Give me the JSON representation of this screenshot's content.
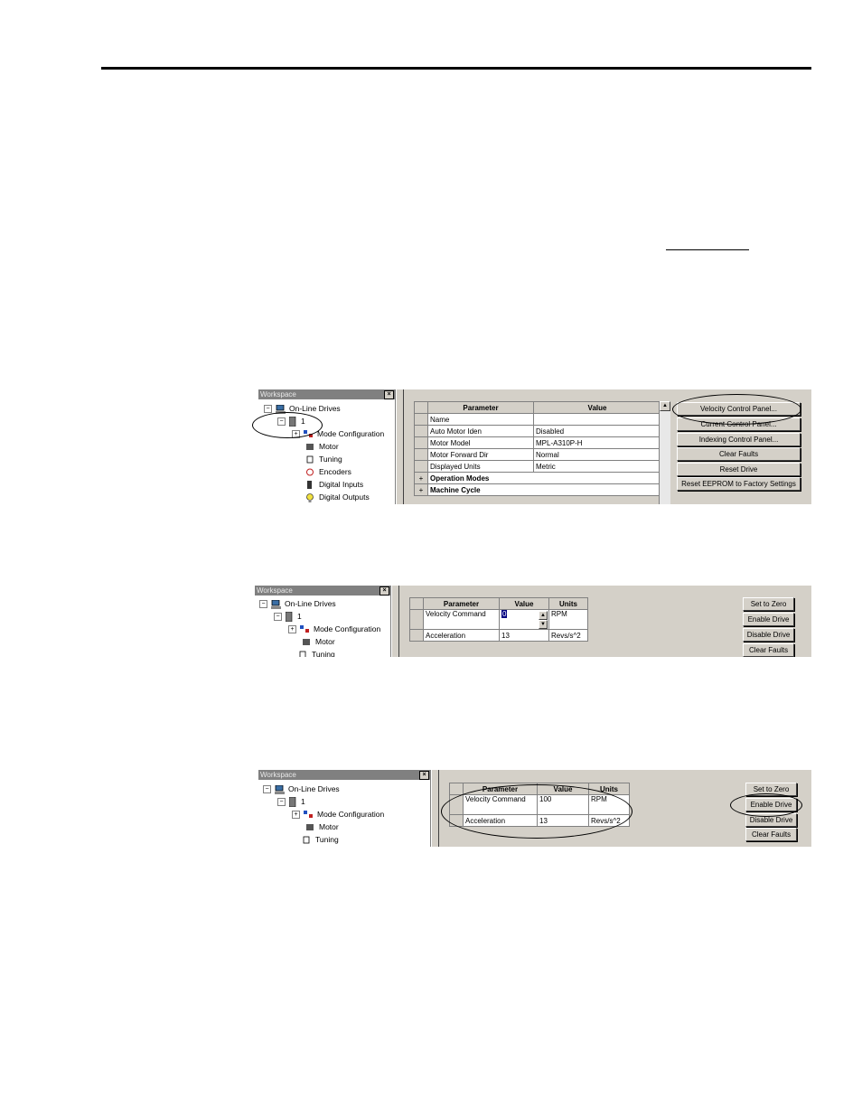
{
  "screenshot1": {
    "workspace_title": "Workspace",
    "close": "×",
    "tree": [
      "On-Line Drives",
      "1",
      "Mode Configuration",
      "Motor",
      "Tuning",
      "Encoders",
      "Digital Inputs",
      "Digital Outputs"
    ],
    "headers": [
      "Parameter",
      "Value"
    ],
    "rows": [
      [
        "Name",
        ""
      ],
      [
        "Auto Motor Iden",
        "Disabled"
      ],
      [
        "Motor Model",
        "MPL-A310P-H"
      ],
      [
        "Motor Forward Dir",
        "Normal"
      ],
      [
        "Displayed Units",
        "Metric"
      ]
    ],
    "groups": [
      "Operation Modes",
      "Machine Cycle"
    ],
    "buttons": [
      "Velocity Control Panel...",
      "Current Control Panel...",
      "Indexing Control Panel...",
      "Clear Faults",
      "Reset Drive",
      "Reset EEPROM to Factory Settings"
    ]
  },
  "screenshot2": {
    "workspace_title": "Workspace",
    "close": "×",
    "tree": [
      "On-Line Drives",
      "1",
      "Mode Configuration",
      "Motor",
      "Tuning"
    ],
    "headers": [
      "Parameter",
      "Value",
      "Units"
    ],
    "rows": [
      [
        "Velocity Command",
        "0",
        "RPM"
      ],
      [
        "Acceleration",
        "13",
        "Revs/s^2"
      ]
    ],
    "buttons": [
      "Set to Zero",
      "Enable Drive",
      "Disable Drive",
      "Clear Faults"
    ]
  },
  "screenshot3": {
    "workspace_title": "Workspace",
    "close": "×",
    "tree": [
      "On-Line Drives",
      "1",
      "Mode Configuration",
      "Motor",
      "Tuning"
    ],
    "headers": [
      "Parameter",
      "Value",
      "Units"
    ],
    "rows": [
      [
        "Velocity Command",
        "100",
        "RPM"
      ],
      [
        "Acceleration",
        "13",
        "Revs/s^2"
      ]
    ],
    "buttons": [
      "Set to Zero",
      "Enable Drive",
      "Disable Drive",
      "Clear Faults"
    ]
  }
}
